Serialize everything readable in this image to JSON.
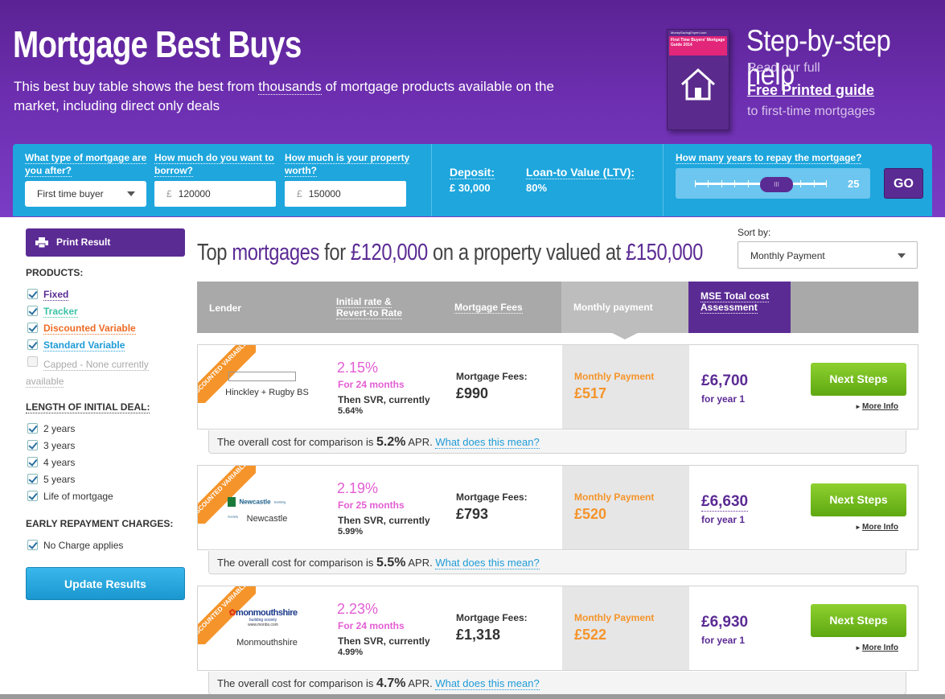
{
  "colors": {
    "purple": "#5b2b94",
    "blue": "#1ea6dd",
    "orange": "#f5942a",
    "pink": "#e35ed3",
    "green": "#6cbd1c"
  },
  "header": {
    "title": "Mortgage Best Buys",
    "desc_pre": "This best buy table shows the best from ",
    "desc_link": "thousands",
    "desc_post": " of mortgage products available on the market, including direct only deals",
    "guide_cover_site": "MoneySavingExpert.com",
    "guide_cover_title": "First Time Buyers' Mortgage Guide 2014",
    "guide_cover_icon": "house-icon",
    "help_title": "Step-by-step help",
    "help_line1": "Read our full",
    "help_link": "Free Printed guide",
    "help_line3": "to first-time mortgages"
  },
  "search": {
    "type_label": "What type of mortgage are you after?",
    "type_value": "First time buyer",
    "borrow_label": "How much do you want to borrow?",
    "borrow_currency": "£",
    "borrow_value": "120000",
    "worth_label": "How much is your property worth?",
    "worth_currency": "£",
    "worth_value": "150000",
    "deposit_label": "Deposit:",
    "deposit_value": "£ 30,000",
    "ltv_label": "Loan-to Value (LTV):",
    "ltv_value": "80%",
    "years_label": "How many years to repay the mortgage?",
    "years_value": "25",
    "slider_grip": "III",
    "go_label": "GO"
  },
  "sidebar": {
    "print_label": "Print Result",
    "print_icon": "printer-icon",
    "products_heading": "PRODUCTS:",
    "products": [
      {
        "label": "Fixed",
        "color": "#5b2b94",
        "checked": true
      },
      {
        "label": "Tracker",
        "color": "#3cc2a6",
        "checked": true
      },
      {
        "label": "Discounted Variable",
        "color": "#ee6a22",
        "checked": true
      },
      {
        "label": "Standard Variable",
        "color": "#1e9bd7",
        "checked": true
      },
      {
        "label": "Capped - None currently available",
        "color": "#aaaaaa",
        "checked": false
      }
    ],
    "length_heading": "LENGTH OF INITIAL DEAL:",
    "lengths": [
      "2 years",
      "3 years",
      "4 years",
      "5 years",
      "Life of mortgage"
    ],
    "erc_heading": "EARLY REPAYMENT CHARGES:",
    "erc_option": "No Charge applies",
    "update_label": "Update Results"
  },
  "main": {
    "title_a": "Top ",
    "title_b": "mortgages",
    "title_c": " for ",
    "title_d": "£120,000",
    "title_e": " on a property valued at ",
    "title_f": "£150,000",
    "sort_label": "Sort by:",
    "sort_value": "Monthly Payment"
  },
  "table": {
    "col_lender": "Lender",
    "col_rate": "Initial rate & Revert-to Rate",
    "col_fees": "Mortgage Fees",
    "col_monthly": "Monthly payment",
    "col_mse": "MSE Total cost Assessment"
  },
  "rows": [
    {
      "ribbon": "DISCOUNTED VARIABLE",
      "logo": "hinckley-rugby-logo",
      "lender": "Hinckley + Rugby BS",
      "rate": "2.15%",
      "for": "For 24 months",
      "then": "Then SVR, currently",
      "svr": "5.64%",
      "fees_label": "Mortgage Fees:",
      "fees": "£990",
      "monthly_label": "Monthly Payment",
      "monthly": "£517",
      "mse": "£6,700",
      "mse_for": "for year 1",
      "next": "Next Steps",
      "more": "More Info",
      "apr_pre": "The overall cost for comparison is",
      "apr": "5.2%",
      "apr_unit": "APR.",
      "apr_link": "What does this mean?"
    },
    {
      "ribbon": "DISCOUNTED VARIABLE",
      "logo": "newcastle-bs-logo",
      "logo_text": "Newcastle",
      "logo_sub": "Building Society",
      "lender": "Newcastle",
      "rate": "2.19%",
      "for": "For 25 months",
      "then": "Then SVR, currently",
      "svr": "5.99%",
      "fees_label": "Mortgage Fees:",
      "fees": "£793",
      "monthly_label": "Monthly Payment",
      "monthly": "£520",
      "mse": "£6,630",
      "mse_for": "for year 1",
      "next": "Next Steps",
      "more": "More Info",
      "apr_pre": "The overall cost for comparison is",
      "apr": "5.5%",
      "apr_unit": "APR.",
      "apr_link": "What does this mean?"
    },
    {
      "ribbon": "DISCOUNTED VARIABLE",
      "logo": "monmouthshire-bs-logo",
      "logo_text": "monmouthshire",
      "logo_sub": "building society",
      "logo_url": "www.monbs.com",
      "lender": "Monmouthshire",
      "rate": "2.23%",
      "for": "For 24 months",
      "then": "Then SVR, currently",
      "svr": "4.99%",
      "fees_label": "Mortgage Fees:",
      "fees": "£1,318",
      "monthly_label": "Monthly Payment",
      "monthly": "£522",
      "mse": "£6,930",
      "mse_for": "for year 1",
      "next": "Next Steps",
      "more": "More Info",
      "apr_pre": "The overall cost for comparison is",
      "apr": "4.7%",
      "apr_unit": "APR.",
      "apr_link": "What does this mean?"
    }
  ]
}
